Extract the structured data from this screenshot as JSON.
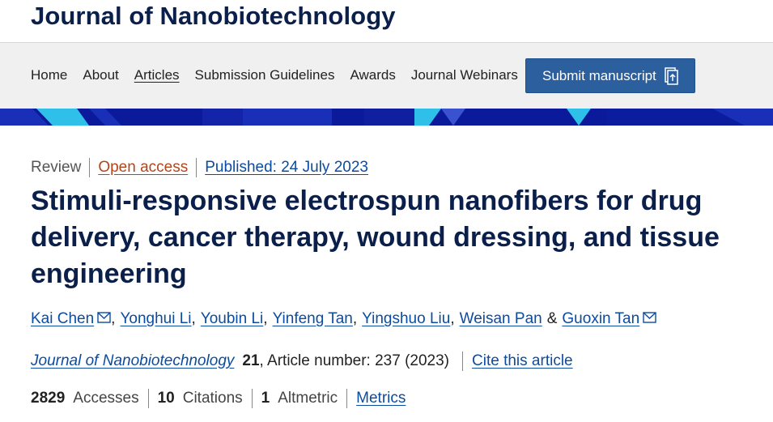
{
  "brand": {
    "title": "Journal of Nanobiotechnology"
  },
  "nav": {
    "items": [
      {
        "label": "Home"
      },
      {
        "label": "About"
      },
      {
        "label": "Articles"
      },
      {
        "label": "Submission Guidelines"
      },
      {
        "label": "Awards"
      },
      {
        "label": "Journal Webinars"
      }
    ],
    "submit_label": "Submit manuscript"
  },
  "article": {
    "type": "Review",
    "access": "Open access",
    "published": "Published: 24 July 2023",
    "title": "Stimuli-responsive electrospun nanofibers for drug delivery, cancer therapy, wound dressing, and tissue engineering",
    "authors": [
      {
        "name": "Kai Chen",
        "sep": ","
      },
      {
        "name": "Yonghui Li",
        "sep": ","
      },
      {
        "name": "Youbin Li",
        "sep": ","
      },
      {
        "name": "Yinfeng Tan",
        "sep": ","
      },
      {
        "name": "Yingshuo Liu",
        "sep": ","
      },
      {
        "name": "Weisan Pan",
        "sep": "&"
      },
      {
        "name": "Guoxin Tan",
        "sep": ""
      }
    ],
    "journal": "Journal of Nanobiotechnology",
    "volume": "21",
    "article_number": ", Article number: 237 (2023)",
    "cite_label": "Cite this article"
  },
  "metrics": {
    "accesses_count": "2829",
    "accesses_label": "Accesses",
    "citations_count": "10",
    "citations_label": "Citations",
    "altmetric_count": "1",
    "altmetric_label": "Altmetric",
    "metrics_link": "Metrics"
  },
  "colors": {
    "brand": "#0b1f4b",
    "link": "#0b4ca0",
    "open_access": "#b3451b",
    "button": "#2b5f9e",
    "banner": "#0a1a9a"
  }
}
